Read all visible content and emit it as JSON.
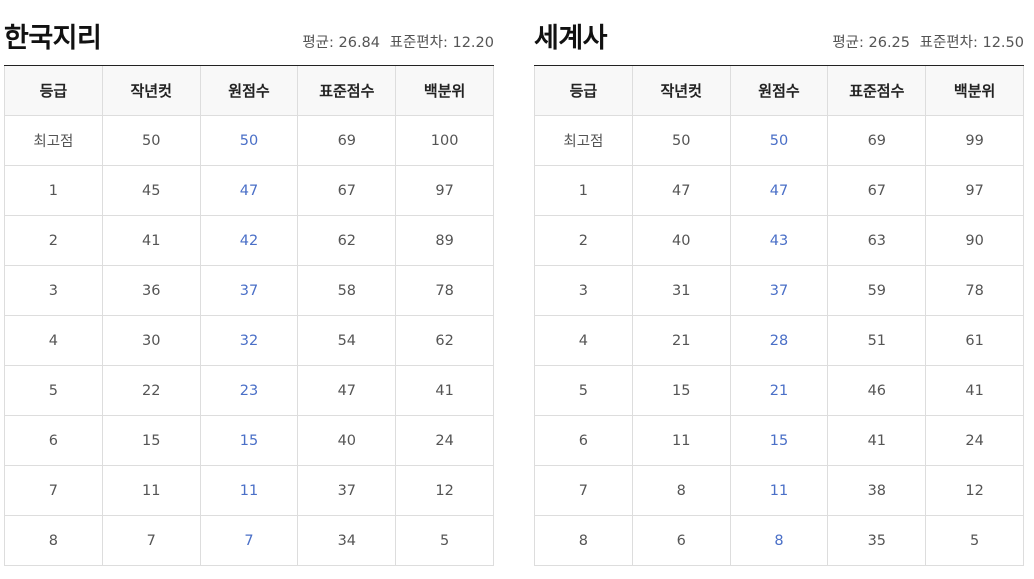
{
  "columns": [
    "등급",
    "작년컷",
    "원점수",
    "표준점수",
    "백분위"
  ],
  "panels": [
    {
      "title": "한국지리",
      "mean_label": "평균:",
      "mean_value": "26.84",
      "sd_label": "표준편차:",
      "sd_value": "12.20",
      "rows": [
        [
          "최고점",
          "50",
          "50",
          "69",
          "100"
        ],
        [
          "1",
          "45",
          "47",
          "67",
          "97"
        ],
        [
          "2",
          "41",
          "42",
          "62",
          "89"
        ],
        [
          "3",
          "36",
          "37",
          "58",
          "78"
        ],
        [
          "4",
          "30",
          "32",
          "54",
          "62"
        ],
        [
          "5",
          "22",
          "23",
          "47",
          "41"
        ],
        [
          "6",
          "15",
          "15",
          "40",
          "24"
        ],
        [
          "7",
          "11",
          "11",
          "37",
          "12"
        ],
        [
          "8",
          "7",
          "7",
          "34",
          "5"
        ]
      ]
    },
    {
      "title": "세계사",
      "mean_label": "평균:",
      "mean_value": "26.25",
      "sd_label": "표준편차:",
      "sd_value": "12.50",
      "rows": [
        [
          "최고점",
          "50",
          "50",
          "69",
          "99"
        ],
        [
          "1",
          "47",
          "47",
          "67",
          "97"
        ],
        [
          "2",
          "40",
          "43",
          "63",
          "90"
        ],
        [
          "3",
          "31",
          "37",
          "59",
          "78"
        ],
        [
          "4",
          "21",
          "28",
          "51",
          "61"
        ],
        [
          "5",
          "15",
          "21",
          "46",
          "41"
        ],
        [
          "6",
          "11",
          "15",
          "41",
          "24"
        ],
        [
          "7",
          "8",
          "11",
          "38",
          "12"
        ],
        [
          "8",
          "6",
          "8",
          "35",
          "5"
        ]
      ]
    }
  ],
  "colors": {
    "raw_score": "#4a6fc7",
    "header_bg": "#f8f8f8",
    "border": "#dddddd",
    "title_rule": "#222222"
  }
}
